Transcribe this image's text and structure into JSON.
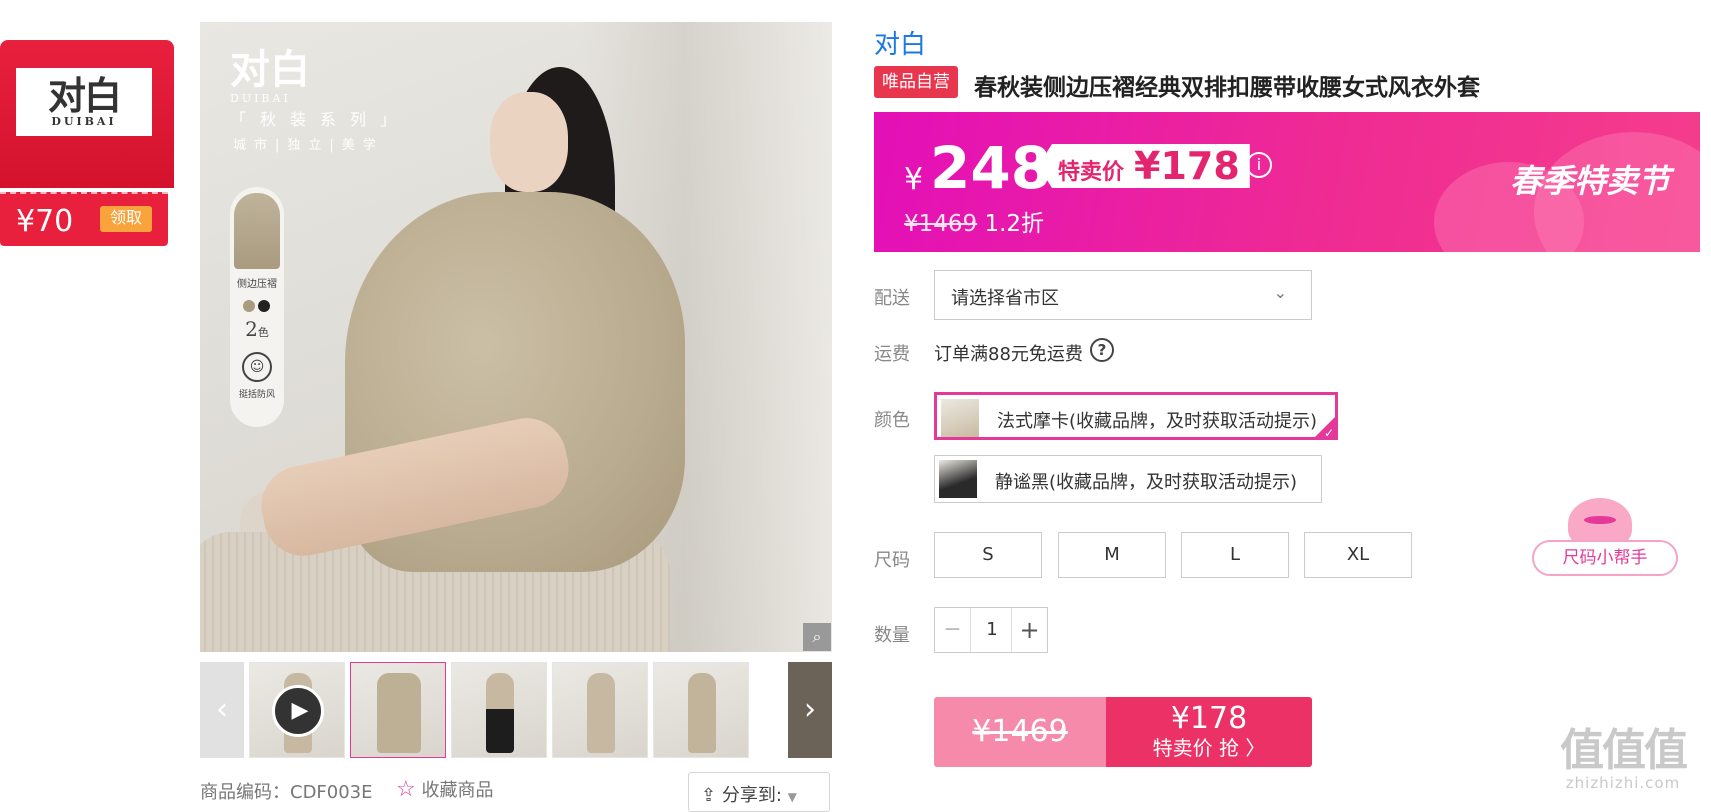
{
  "coupon": {
    "logo_cn": "对白",
    "logo_en": "DUIBAI",
    "amount": "¥70",
    "claim_label": "领取"
  },
  "gallery": {
    "image": {
      "brand_cn": "对白",
      "brand_en": "DUIBAI",
      "series": "「秋装系列」",
      "subtitle": "城市|独立|美学",
      "pill_label": "侧边压褶",
      "colors_count": "2",
      "colors_unit": "色",
      "pill_feature": "挺括防风"
    },
    "zoom_icon": "magnifier-icon",
    "prev_icon": "chevron-left-icon",
    "next_icon": "chevron-right-icon",
    "play_icon": "play-icon"
  },
  "meta": {
    "code_label": "商品编码：CDF003E",
    "fav_label": "收藏商品",
    "share_label": "分享到:"
  },
  "product": {
    "brand": "对白",
    "self_tag": "唯品自营",
    "title": "春秋装侧边压褶经典双排扣腰带收腰女式风衣外套"
  },
  "price": {
    "currency": "¥",
    "main": "248",
    "sale_label": "特卖价",
    "sale_amount": "¥178",
    "original": "¥1469",
    "discount": "1.2折",
    "festival": "春季特卖节",
    "info_icon": "info-icon"
  },
  "shipping": {
    "delivery_label": "配送",
    "region_placeholder": "请选择省市区",
    "fee_label": "运费",
    "fee_text": "订单满88元免运费",
    "help_icon": "question-icon"
  },
  "colors": {
    "label": "颜色",
    "options": [
      {
        "name": "法式摩卡(收藏品牌，及时获取活动提示)",
        "selected": true
      },
      {
        "name": "静谧黑(收藏品牌，及时获取活动提示)",
        "selected": false
      }
    ]
  },
  "sizes": {
    "label": "尺码",
    "options": [
      "S",
      "M",
      "L",
      "XL"
    ],
    "helper_label": "尺码小帮手"
  },
  "quantity": {
    "label": "数量",
    "value": "1",
    "minus": "−",
    "plus": "+"
  },
  "buy": {
    "original": "¥1469",
    "price": "¥178",
    "cta": "特卖价 抢 〉"
  },
  "watermark": {
    "big": "值值值",
    "small": "zhizhizhi.com"
  },
  "colors_theme": {
    "accent": "#e5399a",
    "brand_red": "#e8203e",
    "link": "#1a7ae0"
  }
}
